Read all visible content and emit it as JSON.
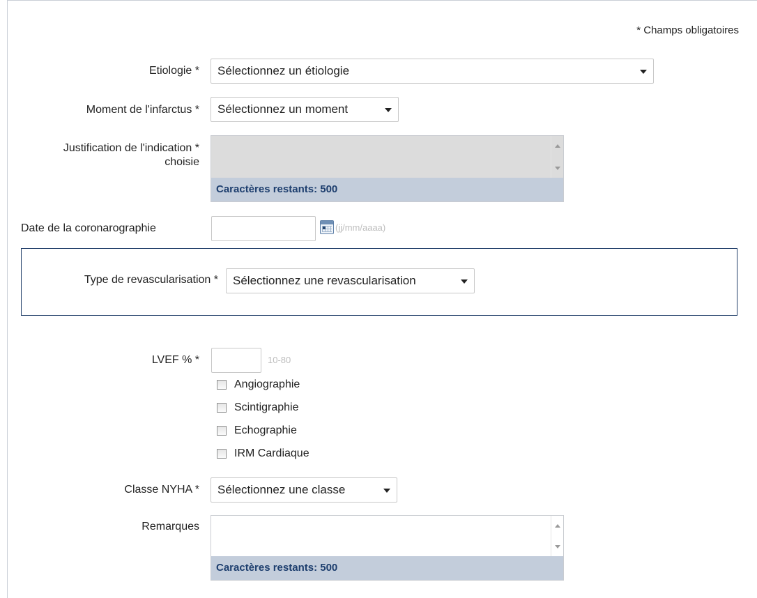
{
  "required_note": "* Champs obligatoires",
  "etiologie": {
    "label": "Etiologie *",
    "selected": "Sélectionnez un étiologie"
  },
  "moment": {
    "label": "Moment de l'infarctus *",
    "selected": "Sélectionnez un moment"
  },
  "justification": {
    "label_line1": "Justification de l'indication *",
    "label_line2": "choisie",
    "counter": "Caractères restants: 500"
  },
  "date_coro": {
    "label": "Date de la coronarographie",
    "value": "",
    "format_hint": "(jj/mm/aaaa)"
  },
  "revascularisation": {
    "label": "Type de revascularisation *",
    "selected": "Sélectionnez une revascularisation"
  },
  "lvef": {
    "label": "LVEF % *",
    "value": "",
    "range_hint": "10-80",
    "methods": [
      {
        "label": "Angiographie",
        "checked": false
      },
      {
        "label": "Scintigraphie",
        "checked": false
      },
      {
        "label": "Echographie",
        "checked": false
      },
      {
        "label": "IRM Cardiaque",
        "checked": false
      }
    ]
  },
  "nyha": {
    "label": "Classe NYHA *",
    "selected": "Sélectionnez une classe"
  },
  "remarques": {
    "label": "Remarques",
    "value": "",
    "counter": "Caractères restants: 500"
  }
}
